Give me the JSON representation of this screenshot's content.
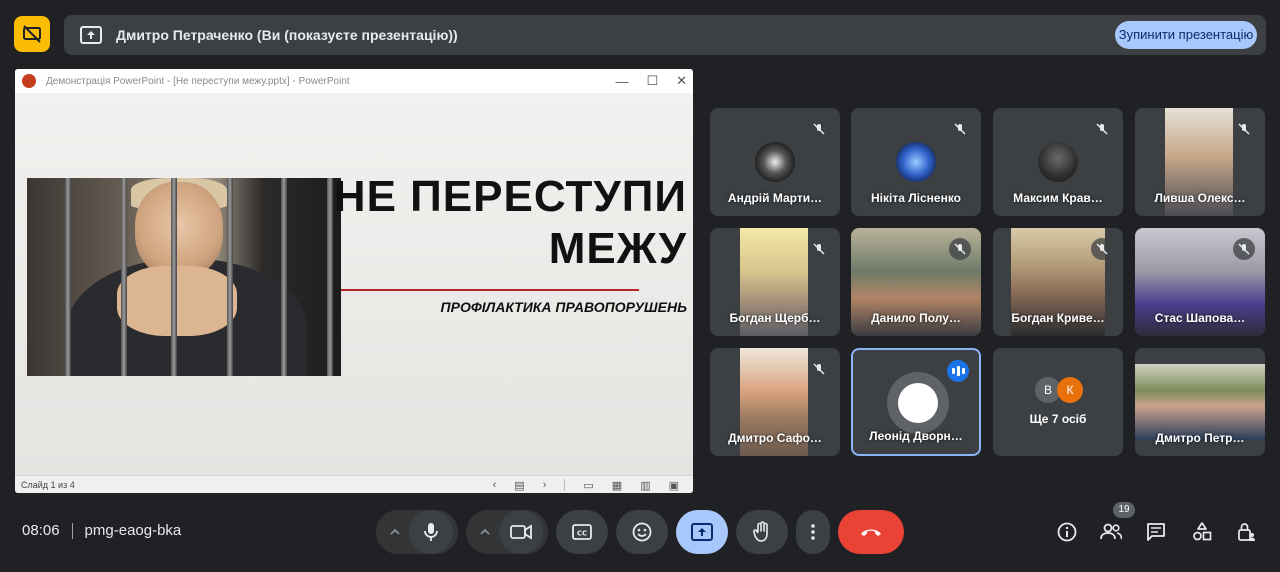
{
  "banner": {
    "presenter_text": "Дмитро Петраченко (Ви (показуєте презентацію))",
    "stop_button_label": "Зупинити презентацію"
  },
  "ppt": {
    "window_title": "Демонстрація PowerPoint - [Не переступи межу.pptx] - PowerPoint",
    "slide_title_line1": "НЕ ПЕРЕСТУПИ",
    "slide_title_line2": "МЕЖУ",
    "slide_subtitle": "ПРОФІЛАКТИКА ПРАВОПОРУШЕНЬ",
    "status_text": "Слайд 1 из 4"
  },
  "participants": [
    {
      "name": "Андрій Марти…"
    },
    {
      "name": "Нікіта Лісненко"
    },
    {
      "name": "Максим Крав…"
    },
    {
      "name": "Ливша Олекс…"
    },
    {
      "name": "Богдан Щерб…"
    },
    {
      "name": "Данило Полу…"
    },
    {
      "name": "Богдан Криве…"
    },
    {
      "name": "Стас Шапова…"
    },
    {
      "name": "Дмитро Сафо…"
    },
    {
      "name": "Леонід Дворн…"
    },
    {
      "name": "Ще 7 осіб",
      "initials": [
        "В",
        "К"
      ]
    },
    {
      "name": "Дмитро Петр…"
    }
  ],
  "meeting": {
    "time": "08:06",
    "code": "pmg-eaog-bka",
    "participant_count": "19"
  },
  "colors": {
    "background": "#202124",
    "tile": "#3c4043",
    "accent_blue": "#a8c7fa",
    "end_call_red": "#ea4335",
    "warning_yellow": "#fbbc04"
  }
}
